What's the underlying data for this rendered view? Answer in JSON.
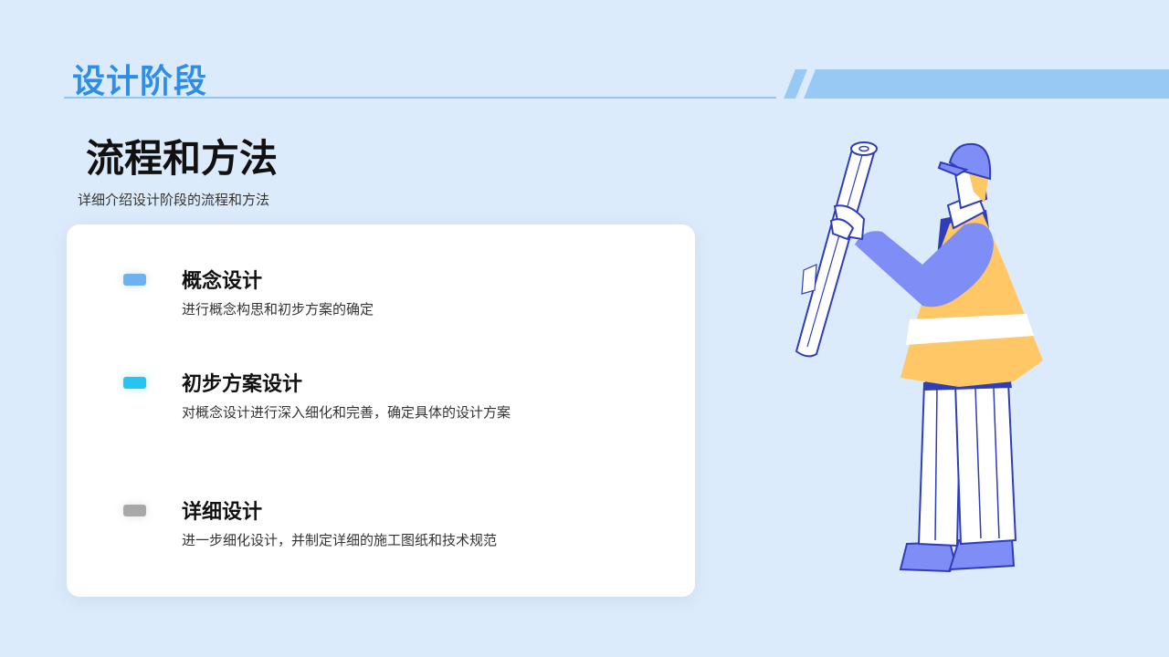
{
  "header": {
    "section_title": "设计阶段"
  },
  "slide": {
    "title": "流程和方法",
    "subtitle": "详细介绍设计阶段的流程和方法"
  },
  "steps": [
    {
      "title": "概念设计",
      "description": "进行概念构思和初步方案的确定",
      "marker_color": "#6fb1f0"
    },
    {
      "title": "初步方案设计",
      "description": "对概念设计进行深入细化和完善，确定具体的设计方案",
      "marker_color": "#27c3f3"
    },
    {
      "title": "详细设计",
      "description": "进一步细化设计，并制定详细的施工图纸和技术规范",
      "marker_color": "#a8a8a8"
    }
  ],
  "colors": {
    "accent": "#2e8ee6",
    "stripe": "#98c9f5",
    "background": "#dcebfb",
    "worker_vest": "#ffc766",
    "worker_sleeve": "#7f8df7",
    "worker_outline": "#2f3db8"
  },
  "illustration": {
    "icon": "worker-holding-blueprint-illustration"
  }
}
